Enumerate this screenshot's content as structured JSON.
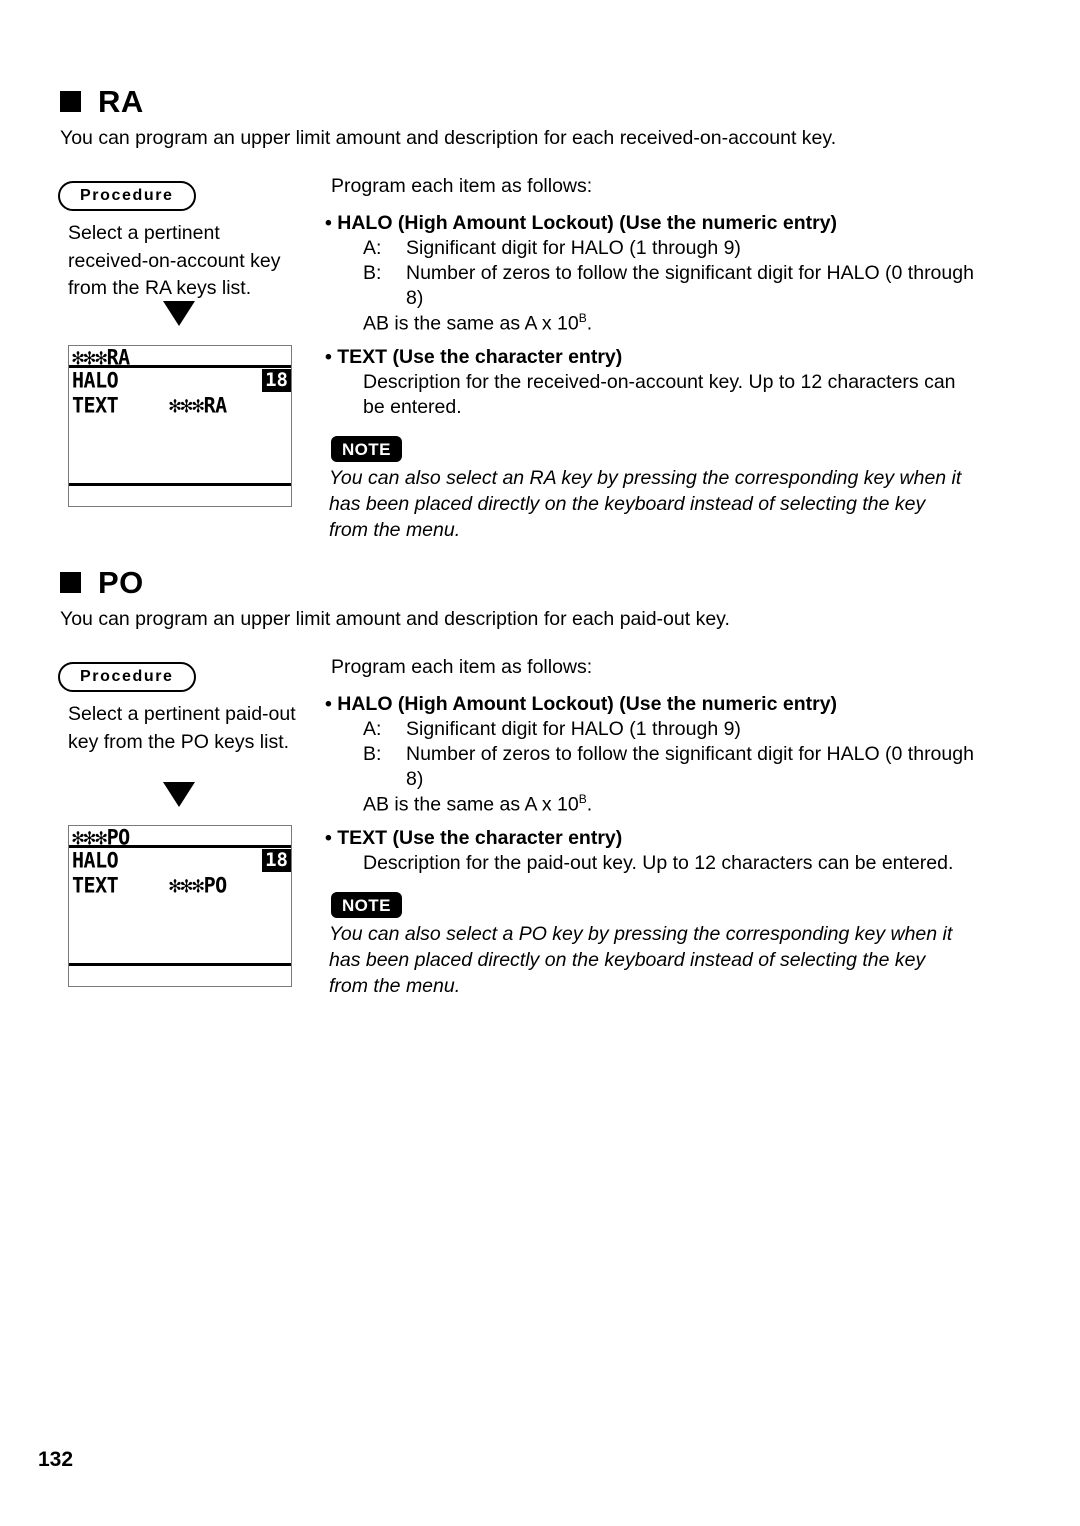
{
  "page": {
    "number": "132"
  },
  "sections": [
    {
      "id": "ra",
      "heading": "RA",
      "intro": "You can program an upper limit amount and description for each received-on-account key.",
      "procedure_label": "Procedure",
      "step_text": "Select a pertinent received-on-account key from the RA keys list.",
      "lcd": {
        "title": "✻✻✻RA",
        "rows": [
          {
            "label": "HALO",
            "value": "",
            "badge": "18"
          },
          {
            "label": "TEXT",
            "value": "✻✻✻RA",
            "badge": ""
          }
        ]
      },
      "right": {
        "program_line": "Program each item as follows:",
        "halo_heading": "• HALO (High Amount Lockout) (Use the numeric entry)",
        "a_label": "A:",
        "a_text": "Significant digit for HALO (1 through 9)",
        "b_label": "B:",
        "b_text": "Number of zeros to follow the significant digit for HALO (0 through 8)",
        "ab_prefix": "AB is the same as A x 10",
        "ab_sup": "B",
        "ab_suffix": ".",
        "text_heading": "• TEXT (Use the character entry)",
        "text_body": "Description for the received-on-account key. Up to 12 characters can be entered.",
        "note_label": "NOTE",
        "note_body": "You can also select an RA key by pressing the corresponding key when it has been placed directly on the keyboard instead of selecting the key from the menu."
      }
    },
    {
      "id": "po",
      "heading": "PO",
      "intro": "You can program an upper limit amount and description for each paid-out key.",
      "procedure_label": "Procedure",
      "step_text": "Select a pertinent paid-out key from the PO keys list.",
      "lcd": {
        "title": "✻✻✻PO",
        "rows": [
          {
            "label": "HALO",
            "value": "",
            "badge": "18"
          },
          {
            "label": "TEXT",
            "value": "✻✻✻PO",
            "badge": ""
          }
        ]
      },
      "right": {
        "program_line": "Program each item as follows:",
        "halo_heading": "• HALO (High Amount Lockout) (Use the numeric entry)",
        "a_label": "A:",
        "a_text": "Significant digit for HALO (1 through 9)",
        "b_label": "B:",
        "b_text": "Number of zeros to follow the significant digit for HALO (0 through 8)",
        "ab_prefix": "AB is the same as A x 10",
        "ab_sup": "B",
        "ab_suffix": ".",
        "text_heading": "• TEXT (Use the character entry)",
        "text_body": "Description for the paid-out key. Up to 12 characters can be entered.",
        "note_label": "NOTE",
        "note_body": "You can also select a PO key by pressing the corresponding key when it has been placed directly on the keyboard instead of selecting the key from the menu."
      }
    }
  ]
}
